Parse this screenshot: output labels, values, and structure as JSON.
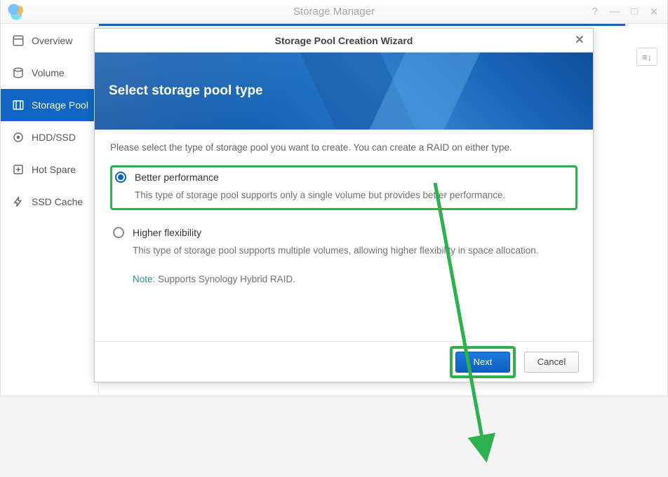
{
  "window": {
    "title": "Storage Manager"
  },
  "sidebar": {
    "items": [
      {
        "label": "Overview"
      },
      {
        "label": "Volume"
      },
      {
        "label": "Storage Pool"
      },
      {
        "label": "HDD/SSD"
      },
      {
        "label": "Hot Spare"
      },
      {
        "label": "SSD Cache"
      }
    ]
  },
  "sort_button_glyph": "≡↓",
  "dialog": {
    "title": "Storage Pool Creation Wizard",
    "banner_heading": "Select storage pool type",
    "intro": "Please select the type of storage pool you want to create. You can create a RAID on either type.",
    "options": [
      {
        "label": "Better performance",
        "desc": "This type of storage pool supports only a single volume but provides better performance.",
        "selected": true
      },
      {
        "label": "Higher flexibility",
        "desc": "This type of storage pool supports multiple volumes, allowing higher flexibility in space allocation.",
        "note_label": "Note:",
        "note_text": " Supports Synology Hybrid RAID.",
        "selected": false
      }
    ],
    "buttons": {
      "next": "Next",
      "cancel": "Cancel"
    }
  }
}
